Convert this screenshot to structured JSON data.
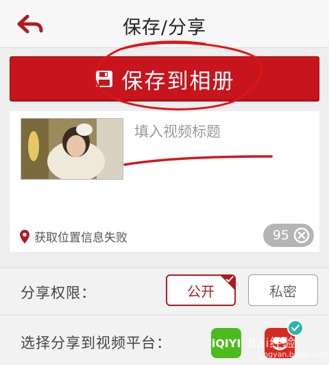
{
  "header": {
    "title": "保存/分享",
    "back_icon": "back-arrow-icon"
  },
  "save_button": {
    "label": "保存到相册",
    "icon": "floppy-disk-icon"
  },
  "video": {
    "title_placeholder": "填入视频标题",
    "location_text": "获取位置信息失败",
    "location_icon": "location-pin-icon",
    "char_count": "95",
    "clear_icon": "clear-circle-icon"
  },
  "share_permission": {
    "label": "分享权限：",
    "options": [
      "公开",
      "私密"
    ],
    "selected": "公开"
  },
  "platforms": {
    "label": "选择分享到视频平台：",
    "items": [
      {
        "name": "iQIYI",
        "logo_text": "iQIYI",
        "selected": false
      },
      {
        "name": "other-platform",
        "selected": true
      }
    ],
    "watermark": "Bai经验",
    "watermark_url": "jingyan.baidu.com"
  },
  "colors": {
    "accent": "#c8141c",
    "iqiyi_green": "#4dbb1c",
    "check_teal": "#2fb4a8"
  }
}
